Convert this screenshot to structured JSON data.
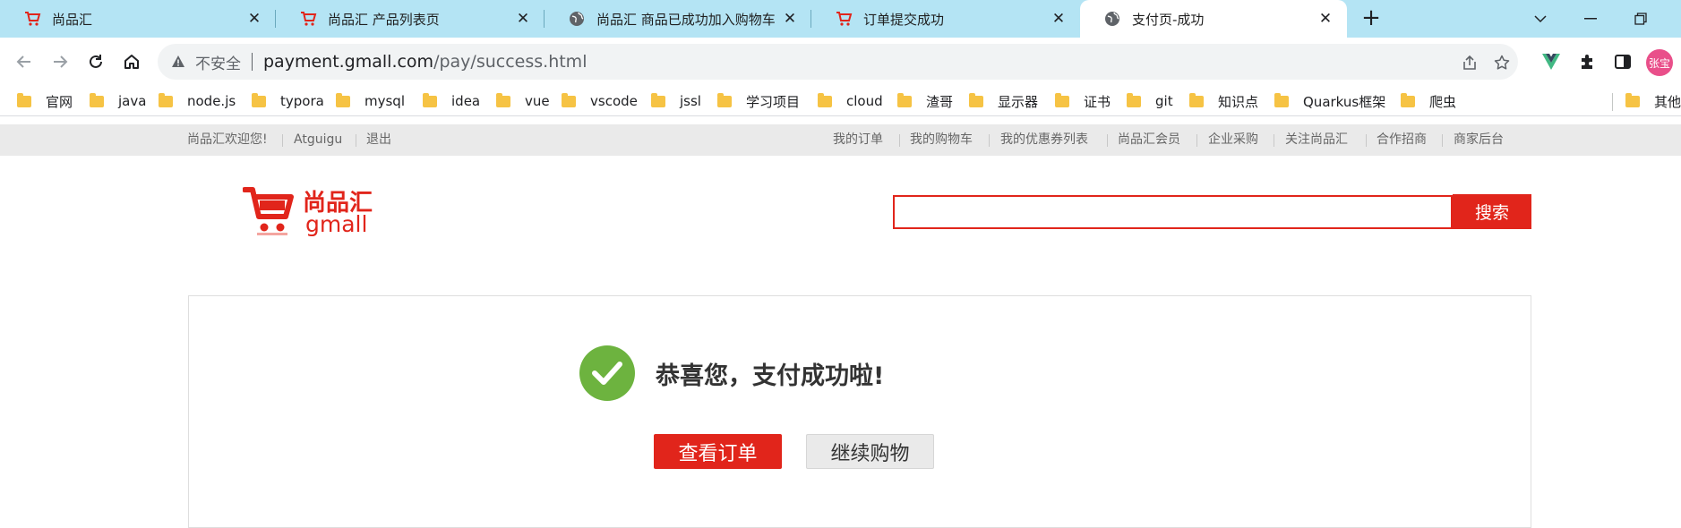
{
  "browser": {
    "tabs": [
      {
        "title": "尚品汇",
        "icon": "cart-icon"
      },
      {
        "title": "尚品汇 产品列表页",
        "icon": "cart-icon"
      },
      {
        "title": "尚品汇 商品已成功加入购物车",
        "icon": "globe-icon"
      },
      {
        "title": "订单提交成功",
        "icon": "cart-icon"
      },
      {
        "title": "支付页-成功",
        "icon": "globe-icon"
      }
    ],
    "new_tab": "+",
    "address": {
      "security_label": "不安全",
      "host": "payment.gmall.com",
      "path": "/pay/success.html"
    },
    "profile_label": "张宝",
    "bookmarks": [
      "官网",
      "java",
      "node.js",
      "typora",
      "mysql",
      "idea",
      "vue",
      "vscode",
      "jssl",
      "学习项目",
      "cloud",
      "渣哥",
      "显示器",
      "证书",
      "git",
      "知识点",
      "Quarkus框架",
      "爬虫"
    ],
    "bookmarks_overflow": "其他书"
  },
  "site": {
    "topbar_left": {
      "welcome": "尚品汇欢迎您!",
      "user": "Atguigu",
      "logout": "退出"
    },
    "topbar_right": [
      "我的订单",
      "我的购物车",
      "我的优惠券列表",
      "尚品汇会员",
      "企业采购",
      "关注尚品汇",
      "合作招商",
      "商家后台"
    ],
    "logo": {
      "cn": "尚品汇",
      "en": "gmall"
    },
    "search": {
      "value": "",
      "button": "搜索"
    },
    "success": {
      "message": "恭喜您，支付成功啦!",
      "view_order": "查看订单",
      "continue_shopping": "继续购物"
    },
    "colors": {
      "brand": "#e1251b",
      "success": "#6db33f"
    }
  }
}
